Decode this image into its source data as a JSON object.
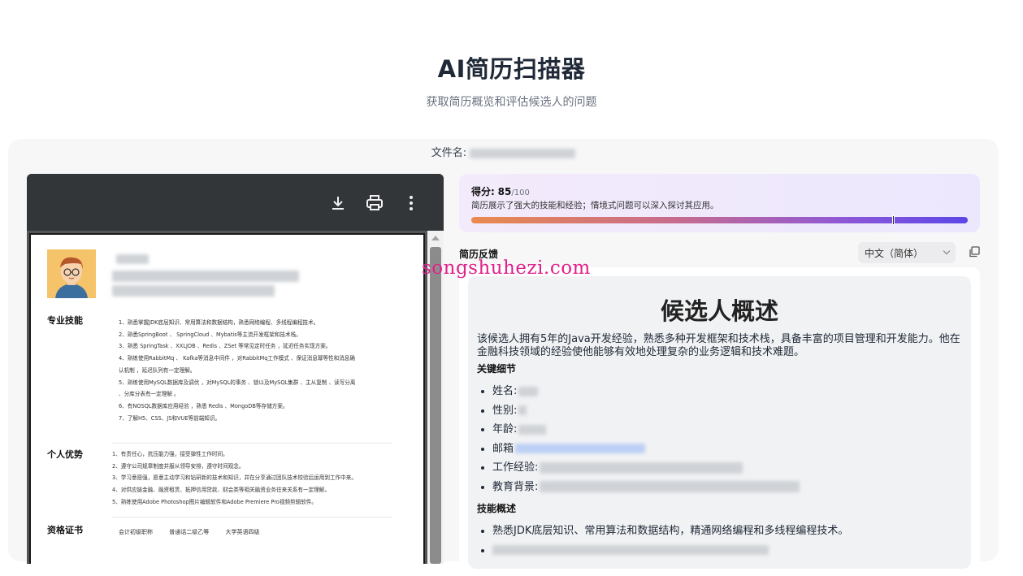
{
  "header": {
    "title": "AI简历扫描器",
    "subtitle": "获取简历概览和评估候选人的问题"
  },
  "file": {
    "label": "文件名:"
  },
  "viewer": {
    "icons": [
      "download-icon",
      "print-icon",
      "more-vertical-icon"
    ],
    "resume": {
      "sections": {
        "skills_title": "专业技能",
        "strengths_title": "个人优势",
        "certs_title": "资格证书"
      },
      "skills": [
        "1、熟悉掌握JDK底层知识、常用算法和数据结构，熟悉网络编程、多线程编程技术。",
        "2、熟悉SpringBoot 、 SpringCloud 、Mybatis等主流开发框架和技术栈。",
        "3、熟悉 SpringTask 、XXLJOB 、Redis 、ZSet 等常见定时任务 ，延迟任务实现方案。",
        "4、熟练使用RabbitMq 、 Kafka等消息中间件 ，对RabbitMq工作模式 、保证消息幂等性和消息确",
        "认机制 ，延迟队列有一定理解。",
        "5、熟练使用MySQL数据库及调优 ，对MySQL的事务 、锁以及MySQL集群 、主从复制 、读写分离",
        "、分库分表有一定理解 。",
        "6、有NOSQL数据库应用经验 ，熟悉 Redis 、MongoDB等存储方案。",
        "7、了解H5、CSS、JS和VUE等前端知识。"
      ],
      "strengths": [
        "1、有责任心，抗压能力强，接受弹性工作时间。",
        "2、遵守公司规章制度并服从领导安排，遵守时间观念。",
        "3、学习意愿强，愿意主动学习和钻研新的技术和知识，并在分享通过团队技术校验后运用到工作中来。",
        "4、对供应链金融、融资租赁、抵押信用贷款、财会类等相关融资业务往来关系有一定理解。",
        "5、熟练使用Adobe Photoshop图片编辑软件和Adobe Premiere Pro视频剪辑软件。"
      ],
      "certs": [
        "会计初级职称",
        "普通话二级乙等",
        "大学英语四级"
      ]
    }
  },
  "score": {
    "label": "得分:",
    "value": "85",
    "max": "/100",
    "fraction": 0.85,
    "description": "简历展示了强大的技能和经验；情境式问题可以深入探讨其应用。"
  },
  "feedback": {
    "label": "简历反馈",
    "language": "中文（简体）"
  },
  "report": {
    "title": "候选人概述",
    "summary": "该候选人拥有5年的Java开发经验，熟悉多种开发框架和技术栈，具备丰富的项目管理和开发能力。他在金融科技领域的经验使他能够有效地处理复杂的业务逻辑和技术难题。",
    "key_details_title": "关键细节",
    "key_details": [
      "姓名:",
      "性别:",
      "年龄:",
      "邮箱",
      "工作经验:",
      "教育背景:"
    ],
    "skills_title": "技能概述",
    "skills": [
      "熟悉JDK底层知识、常用算法和数据结构，精通网络编程和多线程编程技术。"
    ]
  },
  "watermark": "songshuhezi.com"
}
